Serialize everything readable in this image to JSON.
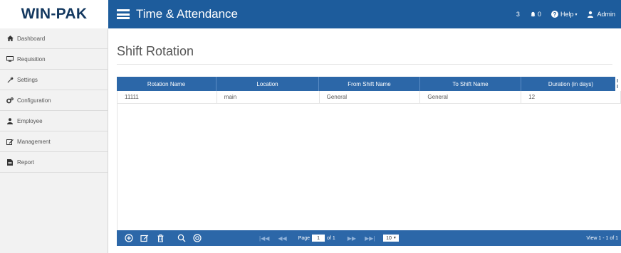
{
  "brand": "WIN-PAK",
  "app_title": "Time & Attendance",
  "topbar": {
    "count": "3",
    "notifications": "0",
    "help": "Help",
    "user": "Admin"
  },
  "sidebar": {
    "items": [
      {
        "label": "Dashboard",
        "icon": "home-icon"
      },
      {
        "label": "Requisition",
        "icon": "monitor-icon"
      },
      {
        "label": "Settings",
        "icon": "wrench-icon"
      },
      {
        "label": "Configuration",
        "icon": "cogs-icon"
      },
      {
        "label": "Employee",
        "icon": "user-icon"
      },
      {
        "label": "Management",
        "icon": "edit-icon"
      },
      {
        "label": "Report",
        "icon": "report-icon"
      }
    ]
  },
  "page": {
    "title": "Shift Rotation"
  },
  "grid": {
    "columns": [
      "Rotation Name",
      "Location",
      "From Shift Name",
      "To Shift Name",
      "Duration (in days)"
    ],
    "rows": [
      [
        "11111",
        "main",
        "General",
        "General",
        "12"
      ]
    ]
  },
  "pager": {
    "page_label": "Page",
    "page_value": "1",
    "of_label": "of 1",
    "rows_per_page": "10",
    "view_text": "View 1 - 1 of 1"
  },
  "colors": {
    "header_blue": "#1d5c9c",
    "grid_blue": "#2c67a8",
    "brand_text": "#13385f"
  }
}
